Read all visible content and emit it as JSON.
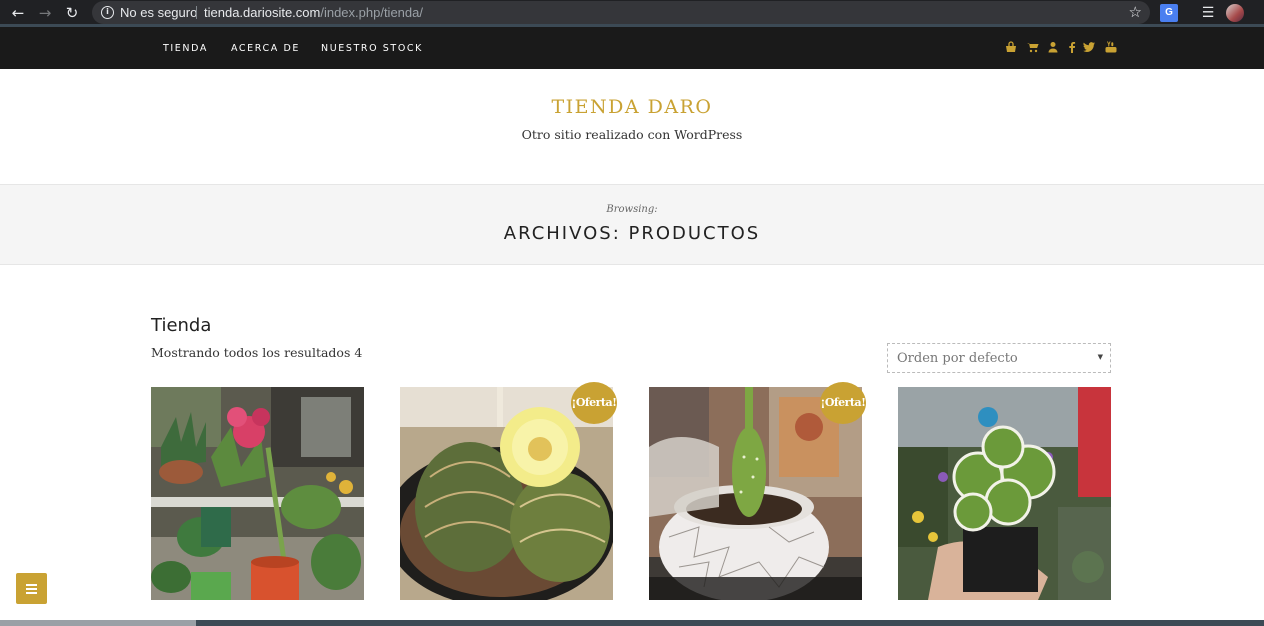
{
  "browser": {
    "security_label": "No es seguro",
    "url_host": "tienda.dariosite.com",
    "url_path": "/index.php/tienda/",
    "translate_label": "G"
  },
  "nav": {
    "items": [
      {
        "label": "TIENDA"
      },
      {
        "label": "ACERCA DE"
      },
      {
        "label": "NUESTRO STOCK"
      }
    ],
    "icons": [
      "bag-icon",
      "cart-icon",
      "user-icon",
      "facebook-icon",
      "twitter-icon",
      "youtube-icon"
    ]
  },
  "site": {
    "title": "TIENDA DARO",
    "tagline": "Otro sitio realizado con WordPress"
  },
  "archive": {
    "browsing": "Browsing:",
    "title": "ARCHIVOS: PRODUCTOS"
  },
  "shop": {
    "title": "Tienda",
    "result_count": "Mostrando todos los resultados 4",
    "orderby": "Orden por defecto",
    "products": [
      {
        "image": "plants-shelf-with-amaryllis",
        "on_sale": false
      },
      {
        "image": "cactus-with-yellow-flower",
        "on_sale": true,
        "badge": "¡Oferta!"
      },
      {
        "image": "cactus-in-white-crackle-pot",
        "on_sale": true,
        "badge": "¡Oferta!"
      },
      {
        "image": "variegated-geranium-in-hand",
        "on_sale": false
      }
    ]
  },
  "colors": {
    "accent": "#c9a233",
    "nav_bg": "#1a1a1a",
    "band_bg": "#f5f5f5"
  }
}
